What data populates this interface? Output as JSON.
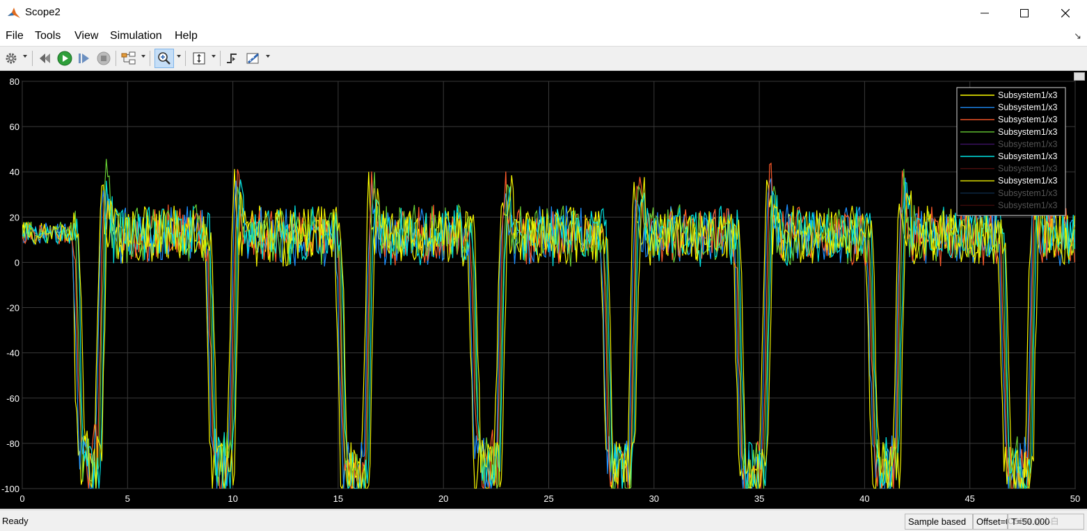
{
  "window": {
    "title": "Scope2"
  },
  "menu": {
    "file": "File",
    "tools": "Tools",
    "view": "View",
    "simulation": "Simulation",
    "help": "Help"
  },
  "status": {
    "ready": "Ready",
    "sample_based": "Sample based",
    "offset": "Offset=0",
    "time": "T=50.000"
  },
  "watermark": "CSDN @小白",
  "colors": {
    "plot_bg": "#000000",
    "grid": "#3a3a3a",
    "axis_text": "#ffffff",
    "toolbar_active": "#c5def7"
  },
  "chart_data": {
    "type": "line",
    "xlim": [
      0,
      50
    ],
    "ylim": [
      -100,
      80
    ],
    "x_ticks": [
      0,
      5,
      10,
      15,
      20,
      25,
      30,
      35,
      40,
      45,
      50
    ],
    "y_ticks": [
      80,
      60,
      40,
      20,
      0,
      -20,
      -40,
      -60,
      -80,
      -100
    ],
    "grid": true,
    "legend_position": "top-right",
    "series": [
      {
        "name": "Subsystem1/x3",
        "color": "#ffff00",
        "visible": true
      },
      {
        "name": "Subsystem1/x3",
        "color": "#1e90ff",
        "visible": true
      },
      {
        "name": "Subsystem1/x3",
        "color": "#ff5a2a",
        "visible": true
      },
      {
        "name": "Subsystem1/x3",
        "color": "#66cc33",
        "visible": true
      },
      {
        "name": "Subsystem1/x3",
        "color": "#8a2be2",
        "visible": false
      },
      {
        "name": "Subsystem1/x3",
        "color": "#00e5e5",
        "visible": true
      },
      {
        "name": "Subsystem1/x3",
        "color": "#b22222",
        "visible": false
      },
      {
        "name": "Subsystem1/x3",
        "color": "#f0f000",
        "visible": true
      },
      {
        "name": "Subsystem1/x3",
        "color": "#1f5fa0",
        "visible": false
      },
      {
        "name": "Subsystem1/x3",
        "color": "#8b1a1a",
        "visible": false
      }
    ],
    "waveform": {
      "baseline": 12,
      "drops": [
        {
          "start": 2.5,
          "end": 3.6,
          "min": -88
        },
        {
          "start": 8.8,
          "end": 9.9,
          "min": -90
        },
        {
          "start": 15.0,
          "end": 16.3,
          "min": -96
        },
        {
          "start": 21.3,
          "end": 22.6,
          "min": -90
        },
        {
          "start": 27.6,
          "end": 28.9,
          "min": -92
        },
        {
          "start": 33.9,
          "end": 35.2,
          "min": -94
        },
        {
          "start": 40.2,
          "end": 41.5,
          "min": -92
        },
        {
          "start": 46.5,
          "end": 47.8,
          "min": -93
        }
      ]
    }
  }
}
